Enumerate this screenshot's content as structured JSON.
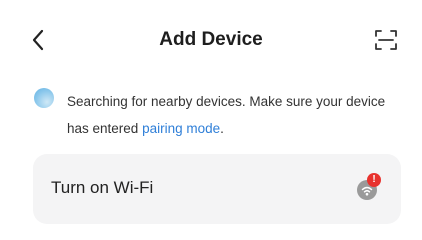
{
  "header": {
    "title": "Add Device",
    "back_icon": "chevron-left-icon",
    "scan_icon": "scan-frame-icon"
  },
  "search": {
    "status_text": "Searching for nearby devices. Make sure your device",
    "status_text_cont": "has entered ",
    "link_text": "pairing mode",
    "trailing": ".",
    "icon": "searching-spinner-icon"
  },
  "wifi_card": {
    "label": "Turn on Wi-Fi",
    "icon": "wifi-off-icon",
    "badge": "!"
  },
  "colors": {
    "link": "#2f7fd8",
    "card_bg": "#f4f4f5",
    "badge": "#e8322e",
    "spinner": "#8ec9ec"
  }
}
